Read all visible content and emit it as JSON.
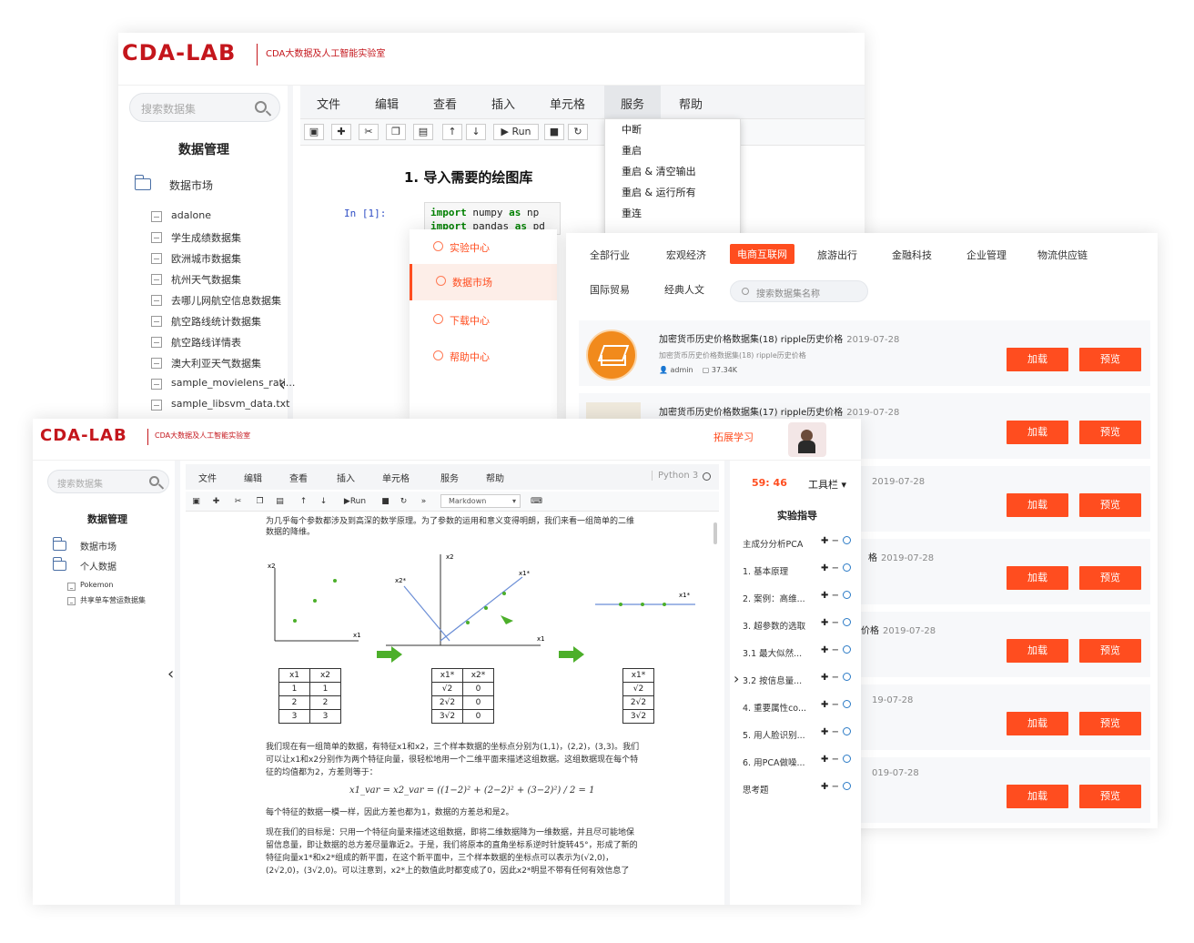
{
  "brand": {
    "logo": "CDA-LAB",
    "subtitle": "CDA大数据及人工智能实验室",
    "accent": "#c4161c",
    "orange": "#ff4d1f"
  },
  "back_window": {
    "search_placeholder": "搜索数据集",
    "section_title": "数据管理",
    "folder": "数据市场",
    "datasets": [
      "adalone",
      "学生成绩数据集",
      "欧洲城市数据集",
      "杭州天气数据集",
      "去哪儿网航空信息数据集",
      "航空路线统计数据集",
      "航空路线详情表",
      "澳大利亚天气数据集",
      "sample_movielens_rati...",
      "sample_libsvm_data.txt"
    ],
    "menu": [
      "文件",
      "编辑",
      "查看",
      "插入",
      "单元格",
      "服务",
      "帮助"
    ],
    "toolbar_run": "Run",
    "heading": "1. 导入需要的绘图库",
    "prompt": "In  [1]:",
    "code": [
      "import numpy as np",
      "import pandas as pd"
    ],
    "service_menu": [
      "中断",
      "重启",
      "重启 & 清空输出",
      "重启 & 运行所有",
      "重连"
    ]
  },
  "side_nav": {
    "items": [
      "实验中心",
      "数据市场",
      "下载中心",
      "帮助中心"
    ]
  },
  "market": {
    "categories_row1": [
      "全部行业",
      "宏观经济",
      "电商互联网",
      "旅游出行",
      "金融科技",
      "企业管理",
      "物流供应链"
    ],
    "categories_row2": [
      "国际贸易",
      "经典人文"
    ],
    "search_placeholder": "搜索数据集名称",
    "cards": [
      {
        "title": "加密货币历史价格数据集(18) ripple历史价格",
        "date": "2019-07-28",
        "desc": "加密货币历史价格数据集(18) ripple历史价格",
        "author": "admin",
        "size": "37.34K"
      },
      {
        "title": "加密货币历史价格数据集(17) ripple历史价格",
        "date": "2019-07-28"
      },
      {
        "title": "",
        "date": "2019-07-28"
      },
      {
        "title": "格",
        "date": "2019-07-28"
      },
      {
        "title": "价格",
        "date": "2019-07-28"
      },
      {
        "title": "",
        "date": "19-07-28"
      },
      {
        "title": "",
        "date": "019-07-28"
      }
    ],
    "btn_load": "加载",
    "btn_preview": "预览"
  },
  "front_window": {
    "link": "拓展学习",
    "search_placeholder": "搜索数据集",
    "section_title": "数据管理",
    "folders": [
      "数据市场",
      "个人数据"
    ],
    "datasets": [
      "Pokemon",
      "共享单车营运数据集"
    ],
    "menu": [
      "文件",
      "编辑",
      "查看",
      "插入",
      "单元格",
      "服务",
      "帮助"
    ],
    "kernel": "Python 3",
    "toolbar_run": "Run",
    "cell_type": "Markdown",
    "timer": "59: 46",
    "tools_label": "工具栏",
    "guide_title": "实验指导",
    "guide_items": [
      "主成分分析PCA",
      "1. 基本原理",
      "2. 案例：高维...",
      "3. 超参数的选取",
      "3.1 最大似然...",
      "3.2 按信息量...",
      "4. 重要属性co...",
      "5. 用人脸识别...",
      "6. 用PCA做噪...",
      "思考题"
    ],
    "text_top": [
      "为几乎每个参数都涉及到高深的数学原理。为了参数的运用和意义变得明朗，我们来看一组简单的二维",
      "数据的降维。"
    ],
    "axis_labels": {
      "x1": "x1",
      "x2": "x2",
      "x1s": "x1*",
      "x2s": "x2*"
    },
    "table1": {
      "head": [
        "x1",
        "x2"
      ],
      "rows": [
        [
          "1",
          "1"
        ],
        [
          "2",
          "2"
        ],
        [
          "3",
          "3"
        ]
      ]
    },
    "table2": {
      "head": [
        "x1*",
        "x2*"
      ],
      "rows": [
        [
          "√2",
          "0"
        ],
        [
          "2√2",
          "0"
        ],
        [
          "3√2",
          "0"
        ]
      ]
    },
    "table3": {
      "head": [
        "x1*"
      ],
      "rows": [
        [
          "√2"
        ],
        [
          "2√2"
        ],
        [
          "3√2"
        ]
      ]
    },
    "text_mid": [
      "我们现在有一组简单的数据，有特征x1和x2，三个样本数据的坐标点分别为(1,1)，(2,2)，(3,3)。我们",
      "可以让x1和x2分别作为两个特征向量，很轻松地用一个二维平面来描述这组数据。这组数据现在每个特",
      "征的均值都为2，方差则等于："
    ],
    "formula": "x1_var = x2_var = ((1−2)² + (2−2)² + (3−2)²) / 2 = 1",
    "text_mid2": "每个特征的数据一模一样，因此方差也都为1，数据的方差总和是2。",
    "text_bottom": [
      "现在我们的目标是：只用一个特征向量来描述这组数据，即将二维数据降为一维数据，并且尽可能地保",
      "留信息量，即让数据的总方差尽量靠近2。于是，我们将原本的直角坐标系逆时针旋转45°，形成了新的",
      "特征向量x1*和x2*组成的新平面，在这个新平面中，三个样本数据的坐标点可以表示为(√2,0)，",
      "(2√2,0)，(3√2,0)。可以注意到，x2*上的数值此时都变成了0，因此x2*明显不带有任何有效信息了"
    ]
  }
}
